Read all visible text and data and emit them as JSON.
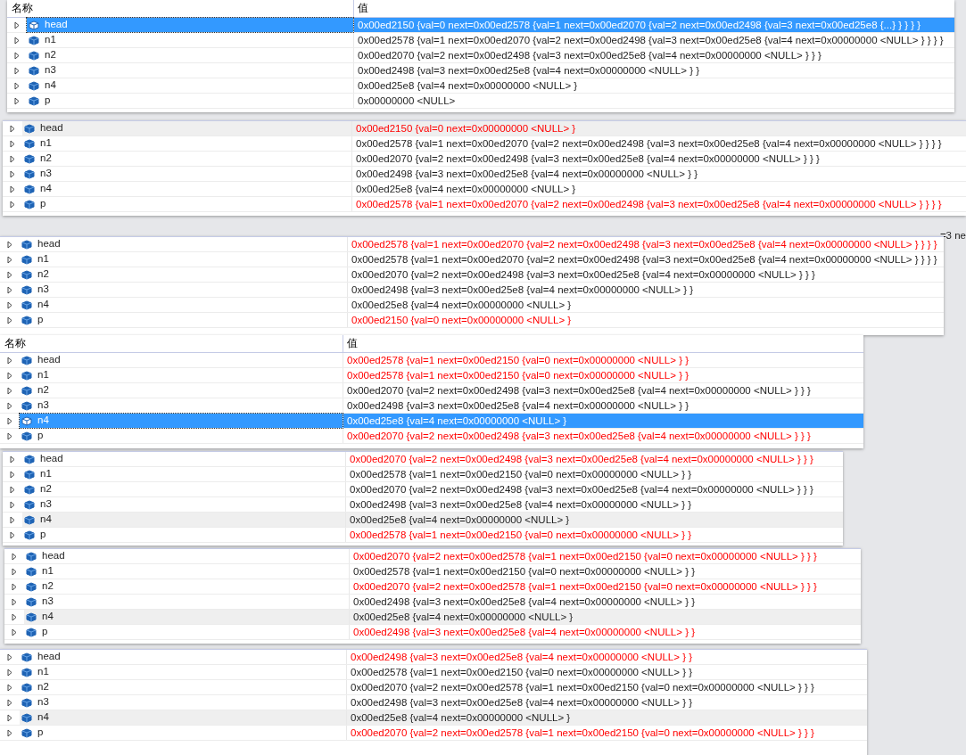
{
  "panels": [
    {
      "header": {
        "name_label": "名称",
        "value_label": "值"
      },
      "rows": [
        {
          "name": "head",
          "value": "0x00ed2150 {val=0 next=0x00ed2578 {val=1 next=0x00ed2070 {val=2 next=0x00ed2498 {val=3 next=0x00ed25e8 {...} } } } }",
          "selected": true
        },
        {
          "name": "n1",
          "value": "0x00ed2578 {val=1 next=0x00ed2070 {val=2 next=0x00ed2498 {val=3 next=0x00ed25e8 {val=4 next=0x00000000 <NULL> } } } }",
          "changed": false,
          "selected": false,
          "highlighted": false
        },
        {
          "name": "n2",
          "value": "0x00ed2070 {val=2 next=0x00ed2498 {val=3 next=0x00ed25e8 {val=4 next=0x00000000 <NULL> } } }",
          "changed": false,
          "selected": false,
          "highlighted": false
        },
        {
          "name": "n3",
          "value": "0x00ed2498 {val=3 next=0x00ed25e8 {val=4 next=0x00000000 <NULL> } }",
          "changed": false,
          "selected": false,
          "highlighted": false
        },
        {
          "name": "n4",
          "value": "0x00ed25e8 {val=4 next=0x00000000 <NULL> }",
          "changed": false,
          "selected": false,
          "highlighted": false
        },
        {
          "name": "p",
          "value": "0x00000000 <NULL>",
          "changed": false,
          "selected": false,
          "highlighted": false
        }
      ]
    },
    {
      "rows": [
        {
          "name": "head",
          "value": "0x00ed2150 {val=0 next=0x00000000 <NULL> }",
          "changed": true,
          "selected": false,
          "highlighted": true
        },
        {
          "name": "n1",
          "value": "0x00ed2578 {val=1 next=0x00ed2070 {val=2 next=0x00ed2498 {val=3 next=0x00ed25e8 {val=4 next=0x00000000 <NULL> } } } }",
          "changed": false,
          "selected": false,
          "highlighted": false
        },
        {
          "name": "n2",
          "value": "0x00ed2070 {val=2 next=0x00ed2498 {val=3 next=0x00ed25e8 {val=4 next=0x00000000 <NULL> } } }",
          "changed": false,
          "selected": false,
          "highlighted": false
        },
        {
          "name": "n3",
          "value": "0x00ed2498 {val=3 next=0x00ed25e8 {val=4 next=0x00000000 <NULL> } }",
          "changed": false,
          "selected": false,
          "highlighted": false
        },
        {
          "name": "n4",
          "value": "0x00ed25e8 {val=4 next=0x00000000 <NULL> }",
          "changed": false,
          "selected": false,
          "highlighted": false
        },
        {
          "name": "p",
          "value": "0x00ed2578 {val=1 next=0x00ed2070 {val=2 next=0x00ed2498 {val=3 next=0x00ed25e8 {val=4 next=0x00000000 <NULL> } } } }",
          "changed": true,
          "selected": false,
          "highlighted": false
        }
      ]
    },
    {
      "rows": [
        {
          "name": "head",
          "value": "0x00ed2578 {val=1 next=0x00ed2070 {val=2 next=0x00ed2498 {val=3 next=0x00ed25e8 {val=4 next=0x00000000 <NULL> } } } }",
          "changed": true,
          "selected": false,
          "highlighted": false
        },
        {
          "name": "n1",
          "value": "0x00ed2578 {val=1 next=0x00ed2070 {val=2 next=0x00ed2498 {val=3 next=0x00ed25e8 {val=4 next=0x00000000 <NULL> } } } }",
          "changed": false,
          "selected": false,
          "highlighted": false
        },
        {
          "name": "n2",
          "value": "0x00ed2070 {val=2 next=0x00ed2498 {val=3 next=0x00ed25e8 {val=4 next=0x00000000 <NULL> } } }",
          "changed": false,
          "selected": false,
          "highlighted": false
        },
        {
          "name": "n3",
          "value": "0x00ed2498 {val=3 next=0x00ed25e8 {val=4 next=0x00000000 <NULL> } }",
          "changed": false,
          "selected": false,
          "highlighted": false
        },
        {
          "name": "n4",
          "value": "0x00ed25e8 {val=4 next=0x00000000 <NULL> }",
          "changed": false,
          "selected": false,
          "highlighted": false
        },
        {
          "name": "p",
          "value": "0x00ed2150 {val=0 next=0x00000000 <NULL> }",
          "changed": true,
          "selected": false,
          "highlighted": false
        }
      ]
    },
    {
      "header": {
        "name_label": "名称",
        "value_label": "值"
      },
      "rows": [
        {
          "name": "head",
          "value": "0x00ed2578 {val=1 next=0x00ed2150 {val=0 next=0x00000000 <NULL> } }",
          "changed": true,
          "selected": false,
          "highlighted": false
        },
        {
          "name": "n1",
          "value": "0x00ed2578 {val=1 next=0x00ed2150 {val=0 next=0x00000000 <NULL> } }",
          "changed": true,
          "selected": false,
          "highlighted": false
        },
        {
          "name": "n2",
          "value": "0x00ed2070 {val=2 next=0x00ed2498 {val=3 next=0x00ed25e8 {val=4 next=0x00000000 <NULL> } } }",
          "changed": false,
          "selected": false,
          "highlighted": false
        },
        {
          "name": "n3",
          "value": "0x00ed2498 {val=3 next=0x00ed25e8 {val=4 next=0x00000000 <NULL> } }",
          "changed": false,
          "selected": false,
          "highlighted": false
        },
        {
          "name": "n4",
          "value": "0x00ed25e8 {val=4 next=0x00000000 <NULL> }",
          "selected": true
        },
        {
          "name": "p",
          "value": "0x00ed2070 {val=2 next=0x00ed2498 {val=3 next=0x00ed25e8 {val=4 next=0x00000000 <NULL> } } }",
          "changed": true,
          "selected": false,
          "highlighted": false
        }
      ]
    },
    {
      "rows": [
        {
          "name": "head",
          "value": "0x00ed2070 {val=2 next=0x00ed2498 {val=3 next=0x00ed25e8 {val=4 next=0x00000000 <NULL> } } }",
          "changed": true,
          "selected": false,
          "highlighted": false
        },
        {
          "name": "n1",
          "value": "0x00ed2578 {val=1 next=0x00ed2150 {val=0 next=0x00000000 <NULL> } }",
          "changed": false,
          "selected": false,
          "highlighted": false
        },
        {
          "name": "n2",
          "value": "0x00ed2070 {val=2 next=0x00ed2498 {val=3 next=0x00ed25e8 {val=4 next=0x00000000 <NULL> } } }",
          "changed": false,
          "selected": false,
          "highlighted": false
        },
        {
          "name": "n3",
          "value": "0x00ed2498 {val=3 next=0x00ed25e8 {val=4 next=0x00000000 <NULL> } }",
          "changed": false,
          "selected": false,
          "highlighted": false
        },
        {
          "name": "n4",
          "value": "0x00ed25e8 {val=4 next=0x00000000 <NULL> }",
          "changed": false,
          "selected": false,
          "highlighted": true
        },
        {
          "name": "p",
          "value": "0x00ed2578 {val=1 next=0x00ed2150 {val=0 next=0x00000000 <NULL> } }",
          "changed": true,
          "selected": false,
          "highlighted": false
        }
      ]
    },
    {
      "rows": [
        {
          "name": "head",
          "value": "0x00ed2070 {val=2 next=0x00ed2578 {val=1 next=0x00ed2150 {val=0 next=0x00000000 <NULL> } } }",
          "changed": true,
          "selected": false,
          "highlighted": false
        },
        {
          "name": "n1",
          "value": "0x00ed2578 {val=1 next=0x00ed2150 {val=0 next=0x00000000 <NULL> } }",
          "changed": false,
          "selected": false,
          "highlighted": false
        },
        {
          "name": "n2",
          "value": "0x00ed2070 {val=2 next=0x00ed2578 {val=1 next=0x00ed2150 {val=0 next=0x00000000 <NULL> } } }",
          "changed": true,
          "selected": false,
          "highlighted": false
        },
        {
          "name": "n3",
          "value": "0x00ed2498 {val=3 next=0x00ed25e8 {val=4 next=0x00000000 <NULL> } }",
          "changed": false,
          "selected": false,
          "highlighted": false
        },
        {
          "name": "n4",
          "value": "0x00ed25e8 {val=4 next=0x00000000 <NULL> }",
          "changed": false,
          "selected": false,
          "highlighted": true
        },
        {
          "name": "p",
          "value": "0x00ed2498 {val=3 next=0x00ed25e8 {val=4 next=0x00000000 <NULL> } }",
          "changed": true,
          "selected": false,
          "highlighted": false
        }
      ]
    },
    {
      "rows": [
        {
          "name": "head",
          "value": "0x00ed2498 {val=3 next=0x00ed25e8 {val=4 next=0x00000000 <NULL> } }",
          "changed": true,
          "selected": false,
          "highlighted": false
        },
        {
          "name": "n1",
          "value": "0x00ed2578 {val=1 next=0x00ed2150 {val=0 next=0x00000000 <NULL> } }",
          "changed": false,
          "selected": false,
          "highlighted": false
        },
        {
          "name": "n2",
          "value": "0x00ed2070 {val=2 next=0x00ed2578 {val=1 next=0x00ed2150 {val=0 next=0x00000000 <NULL> } } }",
          "changed": false,
          "selected": false,
          "highlighted": false
        },
        {
          "name": "n3",
          "value": "0x00ed2498 {val=3 next=0x00ed25e8 {val=4 next=0x00000000 <NULL> } }",
          "changed": false,
          "selected": false,
          "highlighted": false
        },
        {
          "name": "n4",
          "value": "0x00ed25e8 {val=4 next=0x00000000 <NULL> }",
          "changed": false,
          "selected": false,
          "highlighted": true
        },
        {
          "name": "p",
          "value": "0x00ed2070 {val=2 next=0x00ed2578 {val=1 next=0x00ed2150 {val=0 next=0x00000000 <NULL> } } }",
          "changed": true,
          "selected": false,
          "highlighted": false
        }
      ]
    }
  ],
  "background_fragment": "=3 ne"
}
